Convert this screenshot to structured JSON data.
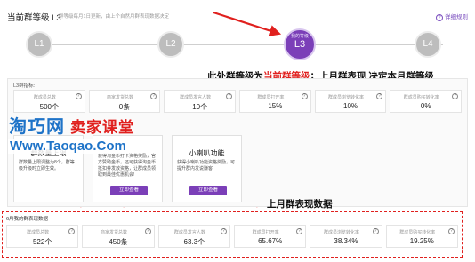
{
  "header": {
    "title": "当前群等级 L3",
    "subtitle": "群等级每月1日更新，由上个自然月群表现数据决定",
    "help_label": "详细规则"
  },
  "levels": [
    {
      "label": "L1",
      "tag": ""
    },
    {
      "label": "L2",
      "tag": ""
    },
    {
      "label": "L3",
      "tag": "我的等级"
    },
    {
      "label": "L4",
      "tag": ""
    }
  ],
  "annotations": {
    "line1_pre": "此处群等级为",
    "line1_highlight": "当前群等级",
    "line1_post": "；上月群表现 决定本月群等级",
    "line2": "上月群表现数据"
  },
  "current_metrics": {
    "title": "L3群指标:",
    "items": [
      {
        "label": "群成员总数",
        "value": "500个"
      },
      {
        "label": "商家发货总数",
        "value": "0条"
      },
      {
        "label": "群成员发言人数",
        "value": "10个"
      },
      {
        "label": "群成员打开率",
        "value": "15%"
      },
      {
        "label": "群成员浏览转化率",
        "value": "10%"
      },
      {
        "label": "群成员购买转化率",
        "value": "0%"
      }
    ]
  },
  "watermark": {
    "site_cn": "淘巧网",
    "site_sub": "卖家课堂",
    "url": "Www.Taoqao.Com"
  },
  "cards": [
    {
      "title": "群数量上限",
      "desc": "群数量上限调整为8个，群等级升级时立即生效。",
      "button": ""
    },
    {
      "title": "",
      "desc": "获得淘金币打卡资格奖励，官方赞助金币，还可获得淘金币抵扣券发放资格，让群成员领取到最佳优惠机会!",
      "button": "立即查看"
    },
    {
      "title": "小喇叭功能",
      "desc": "获得小喇叭功能资格奖励，可提升群内发说赚客!",
      "button": "立即查看"
    }
  ],
  "last_month": {
    "title": "6月我的群表现数据",
    "items": [
      {
        "label": "群成员总数",
        "value": "522个"
      },
      {
        "label": "商家发货总数",
        "value": "450条"
      },
      {
        "label": "群成员发言人数",
        "value": "63.3个"
      },
      {
        "label": "群成员打开率",
        "value": "65.67%"
      },
      {
        "label": "群成员浏览转化率",
        "value": "38.34%"
      },
      {
        "label": "群成员购买转化率",
        "value": "19.25%"
      }
    ]
  },
  "colors": {
    "accent": "#7b3fb8",
    "highlight": "#e0201e",
    "watermark": "#1e73c8"
  }
}
